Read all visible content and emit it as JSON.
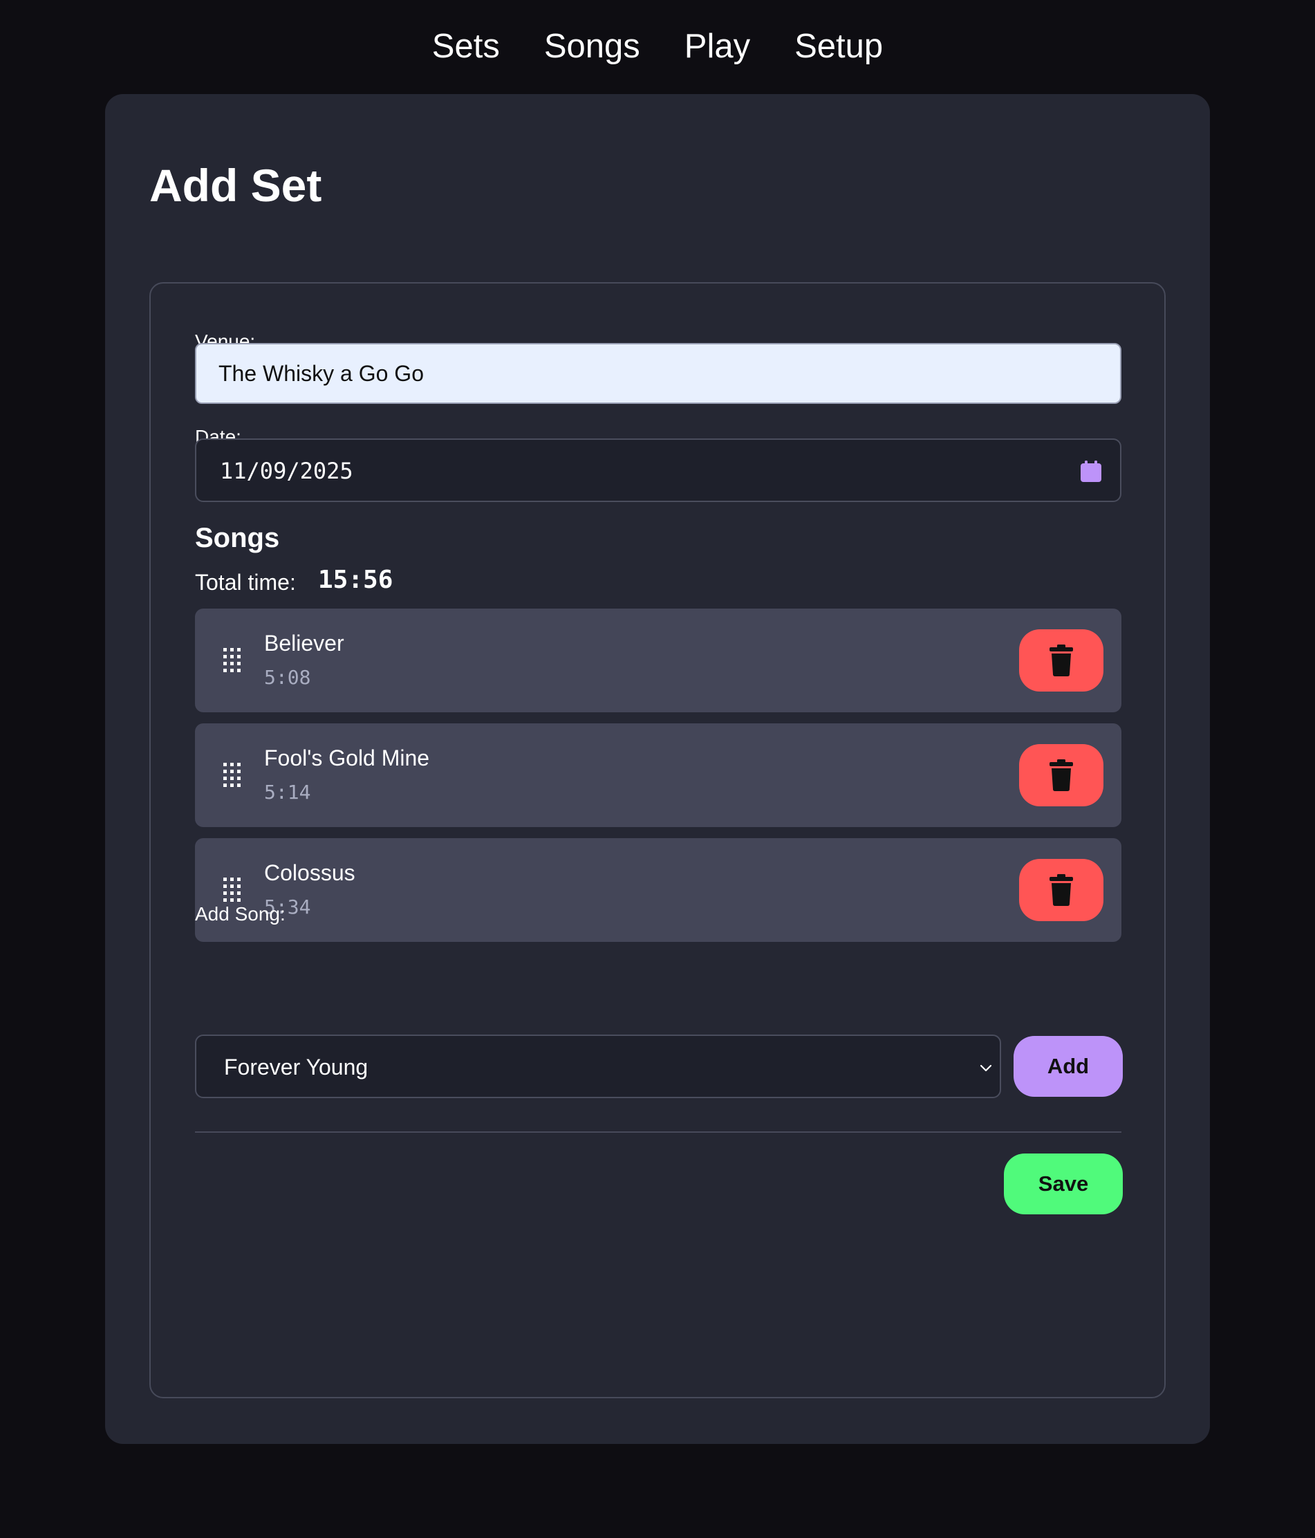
{
  "nav": {
    "items": [
      {
        "label": "Sets"
      },
      {
        "label": "Songs"
      },
      {
        "label": "Play"
      },
      {
        "label": "Setup"
      }
    ]
  },
  "page": {
    "title": "Add Set"
  },
  "form": {
    "venue_label": "Venue:",
    "venue_value": "The Whisky a Go Go",
    "date_label": "Date:",
    "date_value": "11/09/2025",
    "songs_heading": "Songs",
    "total_time_label": "Total time:",
    "total_time_value": "15:56",
    "songs": [
      {
        "title": "Believer",
        "duration": "5:08"
      },
      {
        "title": "Fool's Gold Mine",
        "duration": "5:14"
      },
      {
        "title": "Colossus",
        "duration": "5:34"
      }
    ],
    "add_song_label": "Add Song:",
    "add_song_selected": "Forever Young",
    "add_button_label": "Add",
    "save_button_label": "Save"
  },
  "icons": {
    "drag_handle": "drag-handle-icon",
    "delete": "trash-icon",
    "calendar": "calendar-icon",
    "dropdown": "chevron-down-icon"
  },
  "colors": {
    "background": "#0e0d12",
    "card": "#252733",
    "song_row": "#444658",
    "delete_button": "#ff5555",
    "add_button": "#bd93f9",
    "save_button": "#50fa7b",
    "calendar_icon": "#bd93f9"
  }
}
